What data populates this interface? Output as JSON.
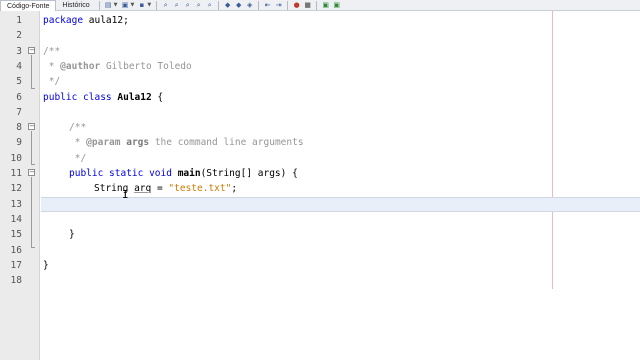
{
  "toolbar": {
    "tabs": [
      {
        "label": "Código-Fonte",
        "active": true
      },
      {
        "label": "Histórico",
        "active": false
      }
    ],
    "icons": [
      "history-icon",
      "back-icon",
      "forward-icon",
      "find-icon",
      "find-prev-icon",
      "find-next-icon",
      "find-selection-icon",
      "toggle-highlight-icon",
      "prev-bookmark-icon",
      "next-bookmark-icon",
      "toggle-bookmark-icon",
      "shift-left-icon",
      "shift-right-icon",
      "record-macro-icon",
      "stop-macro-icon",
      "comment-icon",
      "uncomment-icon"
    ],
    "accent_color": "#3a5c98"
  },
  "editor": {
    "line_numbers": [
      "1",
      "2",
      "3",
      "4",
      "5",
      "6",
      "7",
      "8",
      "9",
      "10",
      "11",
      "12",
      "13",
      "14",
      "15",
      "16",
      "17",
      "18"
    ],
    "current_line": 13,
    "lines": {
      "l1": {
        "kw": "package",
        "rest": " aula12;"
      },
      "l3": {
        "text": "/**"
      },
      "l4": {
        "star": " * ",
        "tag": "@author",
        "val": " Gilberto Toledo"
      },
      "l5": {
        "text": " */"
      },
      "l6": {
        "kw": "public class",
        "name": "Aula12",
        "rest": " {"
      },
      "l8": {
        "text": "/**"
      },
      "l9": {
        "star": " * ",
        "tag": "@param",
        "param": " args",
        "val": " the command line arguments"
      },
      "l10": {
        "text": " */"
      },
      "l11": {
        "kw": "public static void",
        "method": "main",
        "rest": "(String[] args) {"
      },
      "l12": {
        "type": "String",
        "var": "arq",
        "op": " = ",
        "str": "\"teste.txt\"",
        "end": ";"
      },
      "l15": {
        "text": "}"
      },
      "l17": {
        "text": "}"
      }
    },
    "colors": {
      "keyword": "#0000e6",
      "comment": "#969696",
      "string": "#ce7b00",
      "current_line": "#e9eff8",
      "right_margin": "#f2b8b8"
    }
  }
}
